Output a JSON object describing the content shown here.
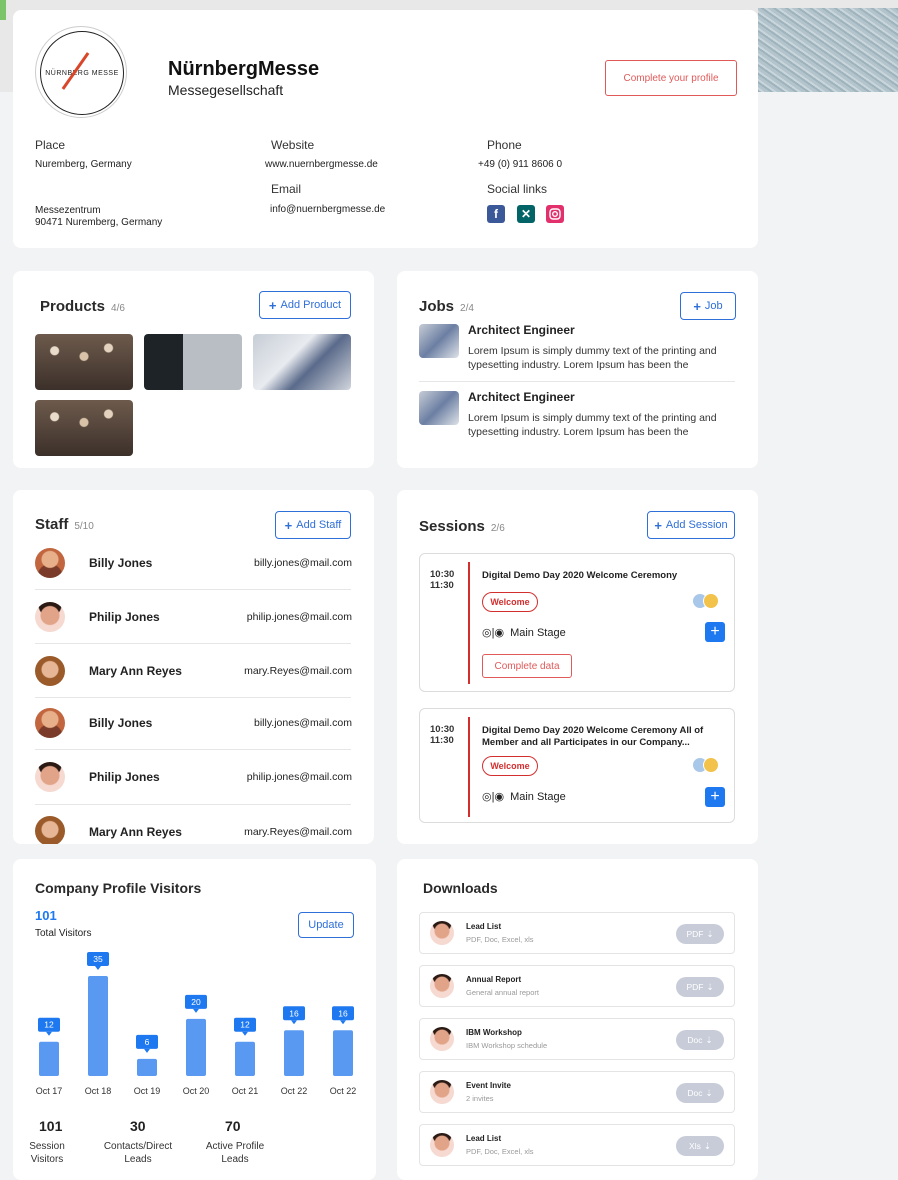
{
  "header": {
    "logo_text": "NÜRNBERG MESSE",
    "company_name": "NürnbergMesse",
    "company_sub": "Messegesellschaft",
    "complete_profile": "Complete your profile",
    "place_label": "Place",
    "place_value": "Nuremberg, Germany",
    "address_line1": "Messezentrum",
    "address_line2": "90471 Nuremberg, Germany",
    "website_label": "Website",
    "website_value": "www.nuernbergmesse.de",
    "email_label": "Email",
    "email_value": "info@nuernbergmesse.de",
    "phone_label": "Phone",
    "phone_value": "+49 (0) 911 8606 0",
    "social_label": "Social links",
    "social_icons": [
      "facebook-icon",
      "xing-icon",
      "instagram-icon"
    ],
    "colors": {
      "facebook": "#3b5998",
      "xing": "#026466",
      "instagram": "#e1306c"
    }
  },
  "products": {
    "title": "Products",
    "count": "4/6",
    "add_label": "Add Product"
  },
  "jobs": {
    "title": "Jobs",
    "count": "2/4",
    "add_label": "Job",
    "items": [
      {
        "title": "Architect Engineer",
        "desc": "Lorem Ipsum is simply dummy text of the printing and typesetting industry. Lorem Ipsum has been the"
      },
      {
        "title": "Architect Engineer",
        "desc": "Lorem Ipsum is simply dummy text of the printing and typesetting industry. Lorem Ipsum has been the"
      }
    ]
  },
  "staff": {
    "title": "Staff",
    "count": "5/10",
    "add_label": "Add Staff",
    "items": [
      {
        "name": "Billy Jones",
        "email": "billy.jones@mail.com"
      },
      {
        "name": "Philip Jones",
        "email": "philip.jones@mail.com"
      },
      {
        "name": "Mary Ann Reyes",
        "email": "mary.Reyes@mail.com"
      },
      {
        "name": "Billy Jones",
        "email": "billy.jones@mail.com"
      },
      {
        "name": "Philip Jones",
        "email": "philip.jones@mail.com"
      },
      {
        "name": "Mary Ann Reyes",
        "email": "mary.Reyes@mail.com"
      }
    ]
  },
  "sessions": {
    "title": "Sessions",
    "count": "2/6",
    "add_label": "Add Session",
    "items": [
      {
        "start": "10:30",
        "end": "11:30",
        "title": "Digital Demo Day 2020 Welcome Ceremony",
        "tag": "Welcome",
        "stage": "Main Stage",
        "action": "Complete data"
      },
      {
        "start": "10:30",
        "end": "11:30",
        "title": "Digital Demo Day 2020 Welcome Ceremony All of Member and all Participates in our Company...",
        "tag": "Welcome",
        "stage": "Main Stage"
      }
    ]
  },
  "visitors": {
    "title": "Company Profile Visitors",
    "total": "101",
    "total_label": "Total Visitors",
    "update_label": "Update",
    "stats": [
      {
        "value": "101",
        "label1": "Session",
        "label2": "Visitors"
      },
      {
        "value": "30",
        "label1": "Contacts/Direct",
        "label2": "Leads"
      },
      {
        "value": "70",
        "label1": "Active Profile",
        "label2": "Leads"
      }
    ]
  },
  "chart_data": {
    "type": "bar",
    "categories": [
      "Oct 17",
      "Oct 18",
      "Oct 19",
      "Oct 20",
      "Oct 21",
      "Oct 22",
      "Oct 22"
    ],
    "values": [
      12,
      35,
      6,
      20,
      12,
      16,
      16
    ],
    "title": "",
    "xlabel": "",
    "ylabel": "",
    "ylim": [
      0,
      35
    ],
    "grid": false,
    "bar_color": "#5a99f2",
    "label_color": "#1e78f0"
  },
  "downloads": {
    "title": "Downloads",
    "items": [
      {
        "title": "Lead List",
        "sub": "PDF, Doc, Excel, xls",
        "btn": "PDF"
      },
      {
        "title": "Annual Report",
        "sub": "General annual report",
        "btn": "PDF"
      },
      {
        "title": "IBM Workshop",
        "sub": "IBM Workshop schedule",
        "btn": "Doc"
      },
      {
        "title": "Event Invite",
        "sub": "2 invites",
        "btn": "Doc"
      },
      {
        "title": "Lead List",
        "sub": "PDF, Doc, Excel, xls",
        "btn": "Xls"
      }
    ]
  }
}
